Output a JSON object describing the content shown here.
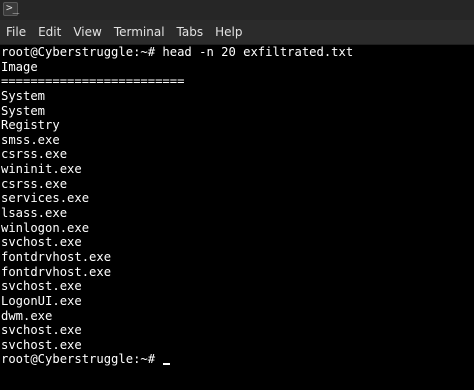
{
  "window": {
    "icon": "terminal-icon",
    "icon_glyph": ">_"
  },
  "menu": {
    "items": [
      "File",
      "Edit",
      "View",
      "Terminal",
      "Tabs",
      "Help"
    ]
  },
  "terminal": {
    "command_line": "root@Cyberstruggle:~# head -n 20 exfiltrated.txt",
    "output": [
      "Image",
      "=========================",
      "System",
      "System",
      "Registry",
      "smss.exe",
      "csrss.exe",
      "wininit.exe",
      "csrss.exe",
      "services.exe",
      "lsass.exe",
      "winlogon.exe",
      "svchost.exe",
      "fontdrvhost.exe",
      "fontdrvhost.exe",
      "svchost.exe",
      "LogonUI.exe",
      "dwm.exe",
      "svchost.exe",
      "svchost.exe"
    ],
    "prompt": "root@Cyberstruggle:~# ",
    "colors": {
      "background": "#000000",
      "foreground": "#ffffff"
    }
  }
}
